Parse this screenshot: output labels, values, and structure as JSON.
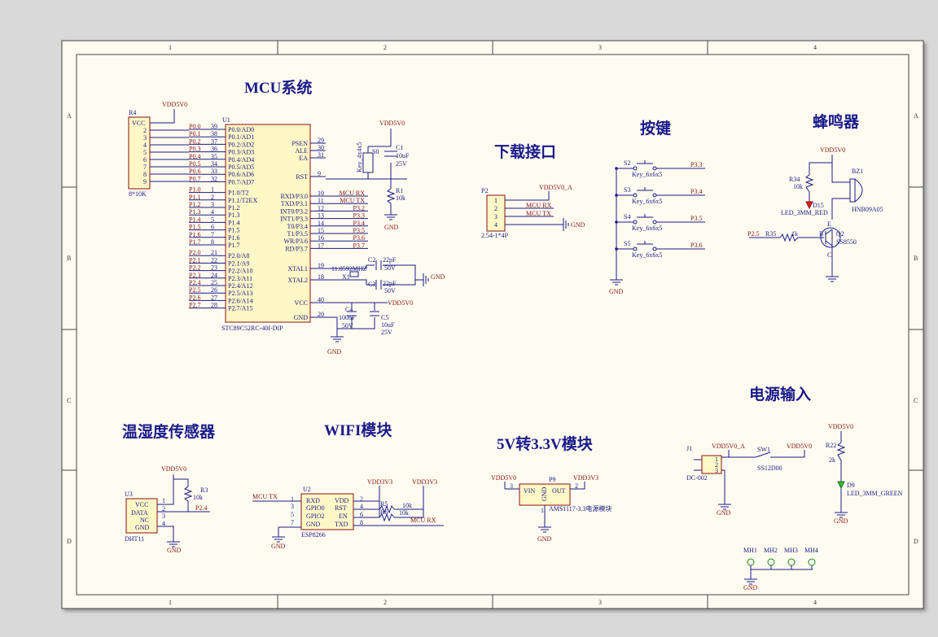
{
  "zones": {
    "columns": [
      "1",
      "2",
      "3",
      "4"
    ],
    "rows": [
      "A",
      "B",
      "C",
      "D"
    ]
  },
  "sections": {
    "mcu": "MCU系统",
    "download": "下载接口",
    "keys": "按键",
    "buzzer": "蜂鸣器",
    "power_in": "电源输入",
    "sensor": "温湿度传感器",
    "wifi": "WIFI模块",
    "ldo": "5V转3.3V模块"
  },
  "power": {
    "vdd5": "VDD5V0",
    "vdd5a": "VDD5V0_A",
    "vdd33": "VDD3V3",
    "gnd": "GND"
  },
  "r4": {
    "ref": "R4",
    "value": "8*10K",
    "pins": [
      "VCC",
      "2",
      "3",
      "4",
      "5",
      "6",
      "7",
      "8",
      "9"
    ]
  },
  "u1": {
    "ref": "U1",
    "part": "STC89C52RC-40I-DIP",
    "left_pins": [
      {
        "net": "P0.0",
        "num": "39",
        "name": "P0.0/AD0"
      },
      {
        "net": "P0.1",
        "num": "38",
        "name": "P0.1/AD1"
      },
      {
        "net": "P0.2",
        "num": "37",
        "name": "P0.2/AD2"
      },
      {
        "net": "P0.3",
        "num": "36",
        "name": "P0.3/AD3"
      },
      {
        "net": "P0.4",
        "num": "35",
        "name": "P0.4/AD4"
      },
      {
        "net": "P0.5",
        "num": "34",
        "name": "P0.5/AD5"
      },
      {
        "net": "P0.6",
        "num": "33",
        "name": "P0.6/AD6"
      },
      {
        "net": "P0.7",
        "num": "32",
        "name": "P0.7/AD7"
      },
      {
        "net": "P1.0",
        "num": "1",
        "name": "P1.0/T2"
      },
      {
        "net": "P1.1",
        "num": "2",
        "name": "P1.1/T2EX"
      },
      {
        "net": "P1.2",
        "num": "3",
        "name": "P1.2"
      },
      {
        "net": "P1.3",
        "num": "4",
        "name": "P1.3"
      },
      {
        "net": "P1.4",
        "num": "5",
        "name": "P1.4"
      },
      {
        "net": "P1.5",
        "num": "6",
        "name": "P1.5"
      },
      {
        "net": "P1.6",
        "num": "7",
        "name": "P1.6"
      },
      {
        "net": "P1.7",
        "num": "8",
        "name": "P1.7"
      },
      {
        "net": "P2.0",
        "num": "21",
        "name": "P2.0/A8"
      },
      {
        "net": "P2.1",
        "num": "22",
        "name": "P2.1/A9"
      },
      {
        "net": "P2.2",
        "num": "23",
        "name": "P2.2/A10"
      },
      {
        "net": "P2.3",
        "num": "24",
        "name": "P2.3/A11"
      },
      {
        "net": "P2.4",
        "num": "25",
        "name": "P2.4/A12"
      },
      {
        "net": "P2.5",
        "num": "26",
        "name": "P2.5/A13"
      },
      {
        "net": "P2.6",
        "num": "27",
        "name": "P2.6/A14"
      },
      {
        "net": "P2.7",
        "num": "28",
        "name": "P2.7/A15"
      }
    ],
    "right_top": [
      {
        "num": "29",
        "name": "PSEN"
      },
      {
        "num": "30",
        "name": "ALE"
      },
      {
        "num": "31",
        "name": "EA"
      },
      {
        "num": "9",
        "name": "RST"
      }
    ],
    "right_mid": [
      {
        "num": "10",
        "name": "RXD/P3.0",
        "net": "MCU RX"
      },
      {
        "num": "11",
        "name": "TXD/P3.1",
        "net": "MCU TX"
      },
      {
        "num": "12",
        "name": "INT0/P3.2",
        "net": "P3.2"
      },
      {
        "num": "13",
        "name": "INT1/P3.3",
        "net": "P3.3"
      },
      {
        "num": "14",
        "name": "T0/P3.4",
        "net": "P3.4"
      },
      {
        "num": "15",
        "name": "T1/P3.5",
        "net": "P3.5"
      },
      {
        "num": "16",
        "name": "WR/P3.6",
        "net": "P3.6"
      },
      {
        "num": "17",
        "name": "RD/P3.7",
        "net": "P3.7"
      }
    ],
    "right_bot": [
      {
        "num": "19",
        "name": "XTAL1"
      },
      {
        "num": "18",
        "name": "XTAL2"
      },
      {
        "num": "40",
        "name": "VCC"
      },
      {
        "num": "20",
        "name": "GND"
      }
    ]
  },
  "reset": {
    "s0": "S0",
    "s0_part": "Key_4x4x5",
    "c1": "C1",
    "c1_value": "10uF",
    "c1_volt": "25V",
    "r1": "R1",
    "r1_value": "10k"
  },
  "crystal": {
    "x1": "X1",
    "x1_value": "11.0592MHZ",
    "c2": "C2",
    "c2_value": "22pF",
    "c2_volt": "50V",
    "c3": "C3",
    "c3_value": "22pF",
    "c3_volt": "50V"
  },
  "decoupling": {
    "c4": "C4",
    "c4_value": "100nF",
    "c4_volt": "50V",
    "c5": "C5",
    "c5_value": "10uF",
    "c5_volt": "25V"
  },
  "p2": {
    "ref": "P2",
    "part": "2.54-1*4P",
    "pins": [
      "1",
      "2",
      "3",
      "4"
    ],
    "nets": [
      "VDD5V0_A",
      "MCU RX",
      "MCU TX"
    ]
  },
  "keys": [
    {
      "ref": "S2",
      "part": "Key_6x6x5",
      "net": "P3.3"
    },
    {
      "ref": "S3",
      "part": "Key_6x6x5",
      "net": "P3.4"
    },
    {
      "ref": "S4",
      "part": "Key_6x6x5",
      "net": "P3.5"
    },
    {
      "ref": "S5",
      "part": "Key_6x6x5",
      "net": "P3.6"
    }
  ],
  "buzzer": {
    "r34": "R34",
    "r34_value": "10k",
    "d15": "D15",
    "d15_part": "LED_3MM_RED",
    "bz1": "BZ1",
    "bz1_part": "HNB09A05",
    "q2": "Q2",
    "q2_part": "SS8550",
    "r35": "R35",
    "r35_value": "1k",
    "net": "P2.5",
    "pin_b": "B",
    "pin_e": "E",
    "pin_c": "C"
  },
  "power_in": {
    "j1": "J1",
    "j1_part": "DC-002",
    "j1_pins": [
      "1",
      "2",
      "3"
    ],
    "sw1": "SW1",
    "sw1_part": "SS12D00",
    "r22": "R22",
    "r22_value": "2k",
    "d9": "D9",
    "d9_part": "LED_3MM_GREEN"
  },
  "mounting": [
    "MH1",
    "MH2",
    "MH3",
    "MH4"
  ],
  "sensor": {
    "u3": "U3",
    "u3_part": "DHT11",
    "pins": [
      "VCC",
      "DATA",
      "NC",
      "GND"
    ],
    "nums": [
      "1",
      "2",
      "3",
      "4"
    ],
    "r3": "R3",
    "r3_value": "10k",
    "net": "P2.4"
  },
  "wifi": {
    "u2": "U2",
    "u2_part": "ESP8266",
    "left": [
      "RXD",
      "GPIO0",
      "GPIO2",
      "GND"
    ],
    "left_nums": [
      "1",
      "3",
      "5",
      "7"
    ],
    "right": [
      "VDD",
      "RST",
      "EN",
      "TXD"
    ],
    "right_nums": [
      "2",
      "4",
      "6",
      "8"
    ],
    "net_tx": "MCU TX",
    "net_rx": "MCU RX",
    "r5": "R5",
    "r5_value": "10k",
    "r6": "R6",
    "r6_value": "10k"
  },
  "ldo": {
    "p9": "P9",
    "part": "AMS1117-3.3电源模块",
    "vin": "VIN",
    "gnd": "GND",
    "out": "OUT",
    "pin3": "3",
    "pin2": "2",
    "pin1": "1"
  }
}
